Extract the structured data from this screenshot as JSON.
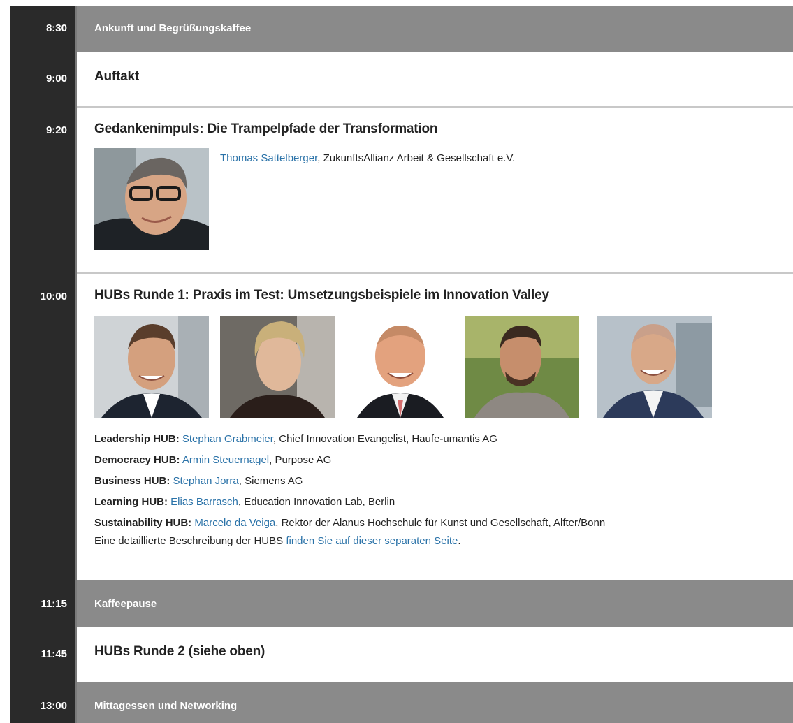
{
  "agenda": {
    "r1": {
      "time": "8:30",
      "title": "Ankunft und Begrüßungskaffee"
    },
    "r2": {
      "time": "9:00",
      "title": "Auftakt"
    },
    "r3": {
      "time": "9:20",
      "title": "Gedankenimpuls: Die Trampelpfade der Transformation",
      "speaker_name": "Thomas Sattelberger",
      "speaker_affiliation": ", ZukunftsAllianz Arbeit & Gesellschaft e.V."
    },
    "r4": {
      "time": "10:00",
      "title": "HUBs Runde 1: Praxis im Test: Umsetzungsbeispiele im Innovation Valley",
      "hubs": [
        {
          "label": "Leadership HUB:",
          "name": "Stephan Grabmeier",
          "detail": ", Chief Innovation Evangelist, Haufe-umantis AG"
        },
        {
          "label": "Democracy HUB:",
          "name": "Armin Steuernagel",
          "detail": ", Purpose AG"
        },
        {
          "label": "Business HUB:",
          "name": "Stephan Jorra",
          "detail": ", Siemens AG"
        },
        {
          "label": "Learning HUB:",
          "name": "Elias Barrasch",
          "detail": ", Education Innovation Lab, Berlin"
        },
        {
          "label": "Sustainability HUB:",
          "name": "Marcelo da Veiga",
          "detail": ", Rektor der Alanus Hochschule für Kunst und Gesellschaft, Alfter/Bonn"
        }
      ],
      "note_prefix": "Eine detaillierte Beschreibung der HUBS ",
      "note_link": "finden Sie auf dieser separaten Seite",
      "note_suffix": "."
    },
    "r5": {
      "time": "11:15",
      "title": "Kaffeepause"
    },
    "r6": {
      "time": "11:45",
      "title": "HUBs Runde 2 (siehe oben)"
    },
    "r7": {
      "time": "13:00",
      "title": "Mittagessen und Networking"
    }
  },
  "colors": {
    "time_bg": "#2a2a2a",
    "gray_row_bg": "#8a8a8a",
    "link": "#2a72a8"
  }
}
